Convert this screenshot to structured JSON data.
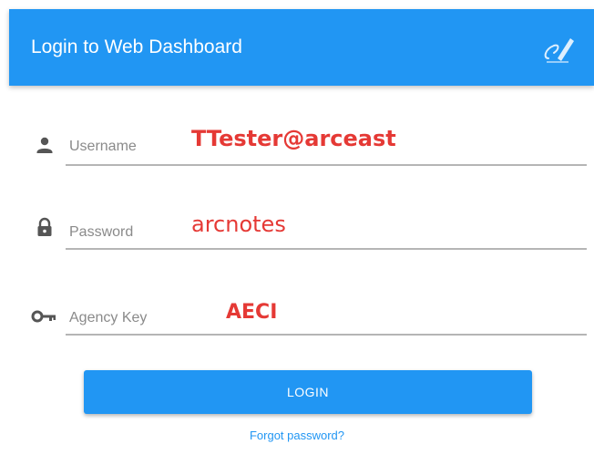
{
  "header": {
    "title": "Login to Web Dashboard",
    "icon": "signature-icon",
    "color": "#2196F3"
  },
  "form": {
    "username": {
      "label": "Username",
      "value": "TTester@arceast",
      "icon": "person-icon"
    },
    "password": {
      "label": "Password",
      "value": "arcnotes",
      "icon": "lock-icon"
    },
    "agency_key": {
      "label": "Agency Key",
      "value": "AECI",
      "icon": "key-icon"
    }
  },
  "actions": {
    "login_label": "LOGIN",
    "forgot_label": "Forgot password?"
  },
  "colors": {
    "accent": "#2196F3",
    "annotation": "#e53935",
    "label": "#8a8a8a"
  }
}
